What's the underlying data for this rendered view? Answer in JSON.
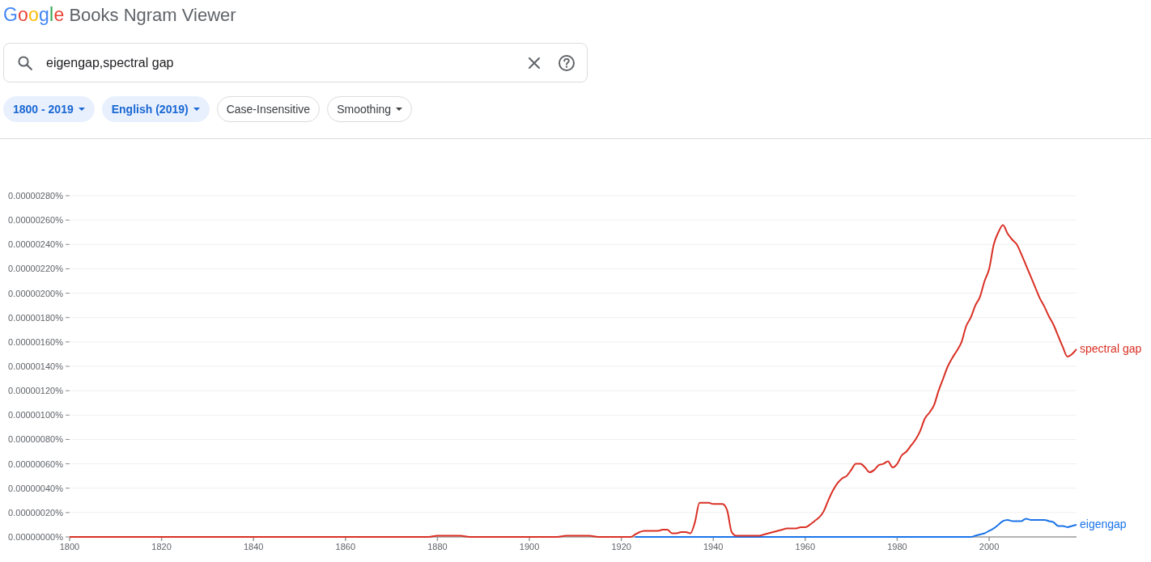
{
  "header": {
    "logo": "Google",
    "title": "Books Ngram Viewer"
  },
  "search": {
    "value": "eigengap,spectral gap"
  },
  "filters": [
    {
      "label": "1800 - 2019",
      "selected": true,
      "dropdown": true
    },
    {
      "label": "English (2019)",
      "selected": true,
      "dropdown": true
    },
    {
      "label": "Case-Insensitive",
      "selected": false,
      "dropdown": false
    },
    {
      "label": "Smoothing",
      "selected": false,
      "dropdown": true
    }
  ],
  "chart": {
    "chart_data": {
      "type": "line",
      "grid": true,
      "x": [
        1800,
        1878,
        1880,
        1885,
        1887,
        1906,
        1908,
        1913,
        1915,
        1922,
        1923,
        1924,
        1925,
        1926,
        1927,
        1928,
        1929,
        1930,
        1931,
        1932,
        1933,
        1934,
        1935,
        1936,
        1937,
        1938,
        1939,
        1940,
        1941,
        1942,
        1943,
        1944,
        1945,
        1946,
        1947,
        1948,
        1949,
        1950,
        1951,
        1952,
        1953,
        1954,
        1955,
        1956,
        1957,
        1958,
        1959,
        1960,
        1961,
        1962,
        1963,
        1964,
        1965,
        1966,
        1967,
        1968,
        1969,
        1970,
        1971,
        1972,
        1973,
        1974,
        1975,
        1976,
        1977,
        1978,
        1979,
        1980,
        1981,
        1982,
        1983,
        1984,
        1985,
        1986,
        1987,
        1988,
        1989,
        1990,
        1991,
        1992,
        1993,
        1994,
        1995,
        1996,
        1997,
        1998,
        1999,
        2000,
        2001,
        2002,
        2003,
        2004,
        2005,
        2006,
        2007,
        2008,
        2009,
        2010,
        2011,
        2012,
        2013,
        2014,
        2015,
        2016,
        2017,
        2018,
        2019
      ],
      "series": [
        {
          "name": "eigengap",
          "color": "#1a73e8",
          "values": [
            null,
            null,
            null,
            null,
            null,
            null,
            null,
            null,
            null,
            null,
            0,
            0,
            0,
            0,
            0,
            0,
            0,
            0,
            0,
            0,
            0,
            0,
            0,
            0,
            0,
            0,
            0,
            0,
            0,
            0,
            0,
            0,
            0,
            0,
            0,
            0,
            0,
            0,
            0,
            0,
            0,
            0,
            0,
            0,
            0,
            0,
            0,
            0,
            0,
            0,
            0,
            0,
            0,
            0,
            0,
            0,
            0,
            0,
            0,
            0,
            0,
            0,
            0,
            0,
            0,
            0,
            0,
            0,
            0,
            0,
            0,
            0,
            0,
            0,
            0,
            0,
            0,
            0,
            0,
            0,
            0,
            0,
            0,
            0,
            1e-08,
            2e-08,
            3e-08,
            5e-08,
            7e-08,
            1e-07,
            1.3e-07,
            1.4e-07,
            1.3e-07,
            1.3e-07,
            1.3e-07,
            1.5e-07,
            1.4e-07,
            1.4e-07,
            1.4e-07,
            1.4e-07,
            1.3e-07,
            1.2e-07,
            9e-08,
            9e-08,
            8e-08,
            9e-08,
            1e-07
          ]
        },
        {
          "name": "spectral gap",
          "color": "#d93025",
          "values": [
            0,
            0,
            1e-08,
            1e-08,
            0,
            0,
            1e-08,
            1e-08,
            0,
            0,
            2e-08,
            4e-08,
            5e-08,
            5e-08,
            5e-08,
            5e-08,
            6e-08,
            6e-08,
            3e-08,
            3e-08,
            4e-08,
            4e-08,
            3e-08,
            1.2e-07,
            2.8e-07,
            2.8e-07,
            2.8e-07,
            2.7e-07,
            2.7e-07,
            2.7e-07,
            2.2e-07,
            4e-08,
            1e-08,
            1e-08,
            1e-08,
            1e-08,
            1e-08,
            1e-08,
            2e-08,
            3e-08,
            4e-08,
            5e-08,
            6e-08,
            7e-08,
            7e-08,
            7e-08,
            8e-08,
            8e-08,
            1e-07,
            1.3e-07,
            1.6e-07,
            2.1e-07,
            3e-07,
            3.8e-07,
            4.4e-07,
            4.8e-07,
            5e-07,
            5.5e-07,
            6e-07,
            6e-07,
            5.7e-07,
            5.3e-07,
            5.5e-07,
            5.9e-07,
            6e-07,
            6.2e-07,
            5.7e-07,
            6e-07,
            6.7e-07,
            7e-07,
            7.5e-07,
            8e-07,
            8.7e-07,
            9.7e-07,
            1.02e-06,
            1.08e-06,
            1.2e-06,
            1.3e-06,
            1.4e-06,
            1.47e-06,
            1.53e-06,
            1.6e-06,
            1.73e-06,
            1.8e-06,
            1.9e-06,
            1.97e-06,
            2.1e-06,
            2.2e-06,
            2.4e-06,
            2.5e-06,
            2.56e-06,
            2.49e-06,
            2.44e-06,
            2.4e-06,
            2.32e-06,
            2.23e-06,
            2.14e-06,
            2.05e-06,
            1.96e-06,
            1.89e-06,
            1.81e-06,
            1.74e-06,
            1.65e-06,
            1.56e-06,
            1.48e-06,
            1.5e-06,
            1.54e-06
          ]
        }
      ],
      "xlim": [
        1800,
        2019
      ],
      "ylim": [
        0,
        2.8e-06
      ],
      "xticks": [
        1800,
        1820,
        1840,
        1860,
        1880,
        1900,
        1920,
        1940,
        1960,
        1980,
        2000
      ],
      "yticks": [
        {
          "value": 0,
          "label": "0.00000000%"
        },
        {
          "value": 2e-07,
          "label": "0.00000020%"
        },
        {
          "value": 4e-07,
          "label": "0.00000040%"
        },
        {
          "value": 6e-07,
          "label": "0.00000060%"
        },
        {
          "value": 8e-07,
          "label": "0.00000080%"
        },
        {
          "value": 1e-06,
          "label": "0.00000100%"
        },
        {
          "value": 1.2e-06,
          "label": "0.00000120%"
        },
        {
          "value": 1.4e-06,
          "label": "0.00000140%"
        },
        {
          "value": 1.6e-06,
          "label": "0.00000160%"
        },
        {
          "value": 1.8e-06,
          "label": "0.00000180%"
        },
        {
          "value": 2e-06,
          "label": "0.00000200%"
        },
        {
          "value": 2.2e-06,
          "label": "0.00000220%"
        },
        {
          "value": 2.4e-06,
          "label": "0.00000240%"
        },
        {
          "value": 2.6e-06,
          "label": "0.00000260%"
        },
        {
          "value": 2.8e-06,
          "label": "0.00000280%"
        }
      ]
    }
  }
}
